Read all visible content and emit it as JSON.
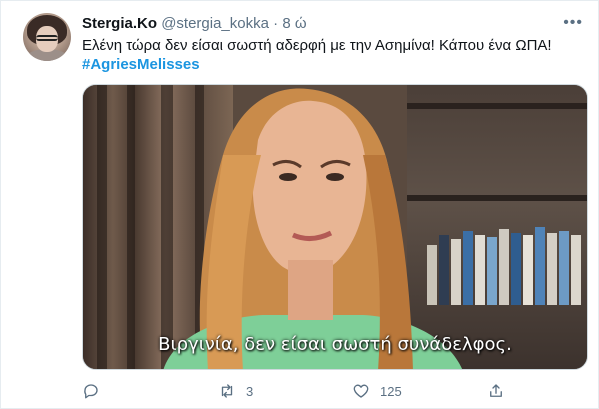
{
  "tweet": {
    "author_name": "Stergia.Ko",
    "handle": "@stergia_kokka",
    "separator": "·",
    "time": "8 ώ",
    "text": "Ελένη τώρα δεν είσαι σωστή αδερφή με την Ασημίνα! Κάπου ένα ΩΠΑ!",
    "hashtag": "#AgriesMelisses",
    "more_label": "•••"
  },
  "media": {
    "subtitle": "Βιργινία, δεν είσαι σωστή συνάδελφος."
  },
  "actions": {
    "reply_count": "",
    "retweet_count": "3",
    "like_count": "125"
  },
  "colors": {
    "link": "#1b95e0",
    "muted": "#5b7083",
    "text": "#0f1419"
  },
  "icons": [
    "more-icon",
    "reply-icon",
    "retweet-icon",
    "like-icon",
    "share-icon"
  ]
}
